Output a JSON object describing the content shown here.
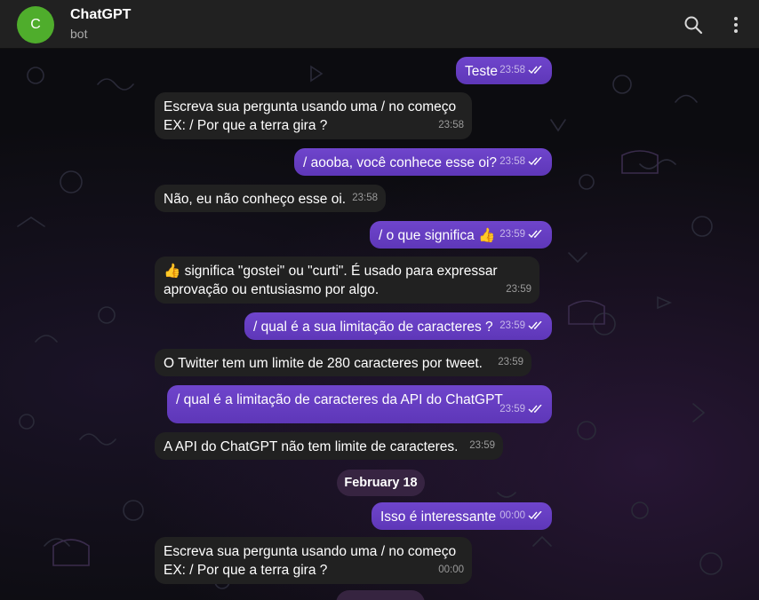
{
  "header": {
    "avatar_letter": "C",
    "avatar_color": "#4fad2c",
    "title": "ChatGPT",
    "subtitle": "bot",
    "icons": [
      "search-icon",
      "more-vertical-icon"
    ]
  },
  "chat": {
    "date_separator": "February 18",
    "messages": [
      {
        "dir": "out",
        "text": "Teste",
        "time": "23:58"
      },
      {
        "dir": "in",
        "text": "Escreva sua pergunta usando uma / no começo\nEX: / Por que a terra gira ?",
        "time": "23:58"
      },
      {
        "dir": "out",
        "text": "/ aooba, você conhece esse oi?",
        "time": "23:58"
      },
      {
        "dir": "in",
        "text": "Não, eu não conheço esse oi.",
        "time": "23:58"
      },
      {
        "dir": "out",
        "text": "/ o que significa 👍",
        "time": "23:59"
      },
      {
        "dir": "in",
        "text": "👍 significa \"gostei\" ou \"curti\". É usado para expressar\naprovação ou entusiasmo por algo.",
        "time": "23:59"
      },
      {
        "dir": "out",
        "text": "/ qual é a sua limitação de caracteres ?",
        "time": "23:59"
      },
      {
        "dir": "in",
        "text": "O Twitter tem um limite de 280 caracteres por tweet.",
        "time": "23:59"
      },
      {
        "dir": "out",
        "text": "/ qual é a limitação de caracteres da API do ChatGPT",
        "time": "23:59"
      },
      {
        "dir": "in",
        "text": "A API do ChatGPT não tem limite de caracteres.",
        "time": "23:59"
      },
      {
        "dir": "out",
        "text": "Isso é interessante",
        "time": "00:00"
      },
      {
        "dir": "in",
        "text": "Escreva sua pergunta usando uma / no começo\nEX: / Por que a terra gira ?",
        "time": "00:00"
      }
    ]
  },
  "colors": {
    "outgoing_bubble": "#6a3fc6",
    "incoming_bubble": "#212121",
    "header_bg": "#212121",
    "chat_bg": "#0c0c10"
  }
}
